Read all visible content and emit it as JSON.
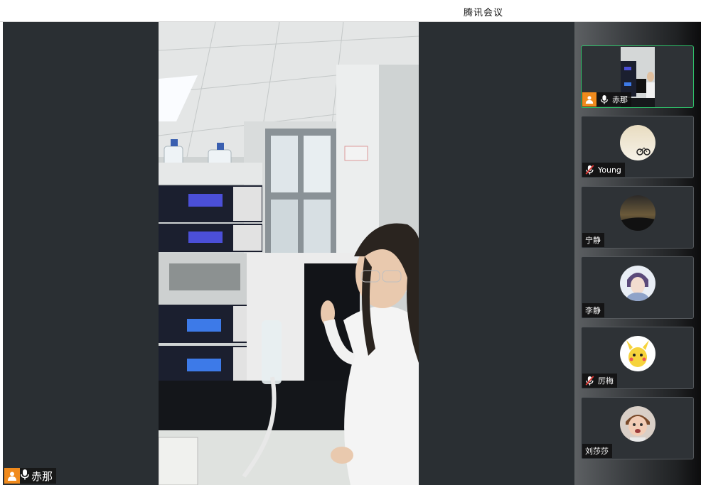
{
  "window": {
    "title": "腾讯会议"
  },
  "main_speaker": {
    "name": "赤那"
  },
  "participants": [
    {
      "name": "赤那",
      "muted": false,
      "active": true
    },
    {
      "name": "Young",
      "muted": true,
      "active": false
    },
    {
      "name": "宁静",
      "muted": false,
      "active": false
    },
    {
      "name": "李静",
      "muted": false,
      "active": false
    },
    {
      "name": "厉梅",
      "muted": true,
      "active": false
    },
    {
      "name": "刘莎莎",
      "muted": false,
      "active": false
    }
  ],
  "colors": {
    "active_border": "#2fc46b",
    "avatar_bg": "#f08a1c",
    "stage_bg": "#2a2f33"
  }
}
